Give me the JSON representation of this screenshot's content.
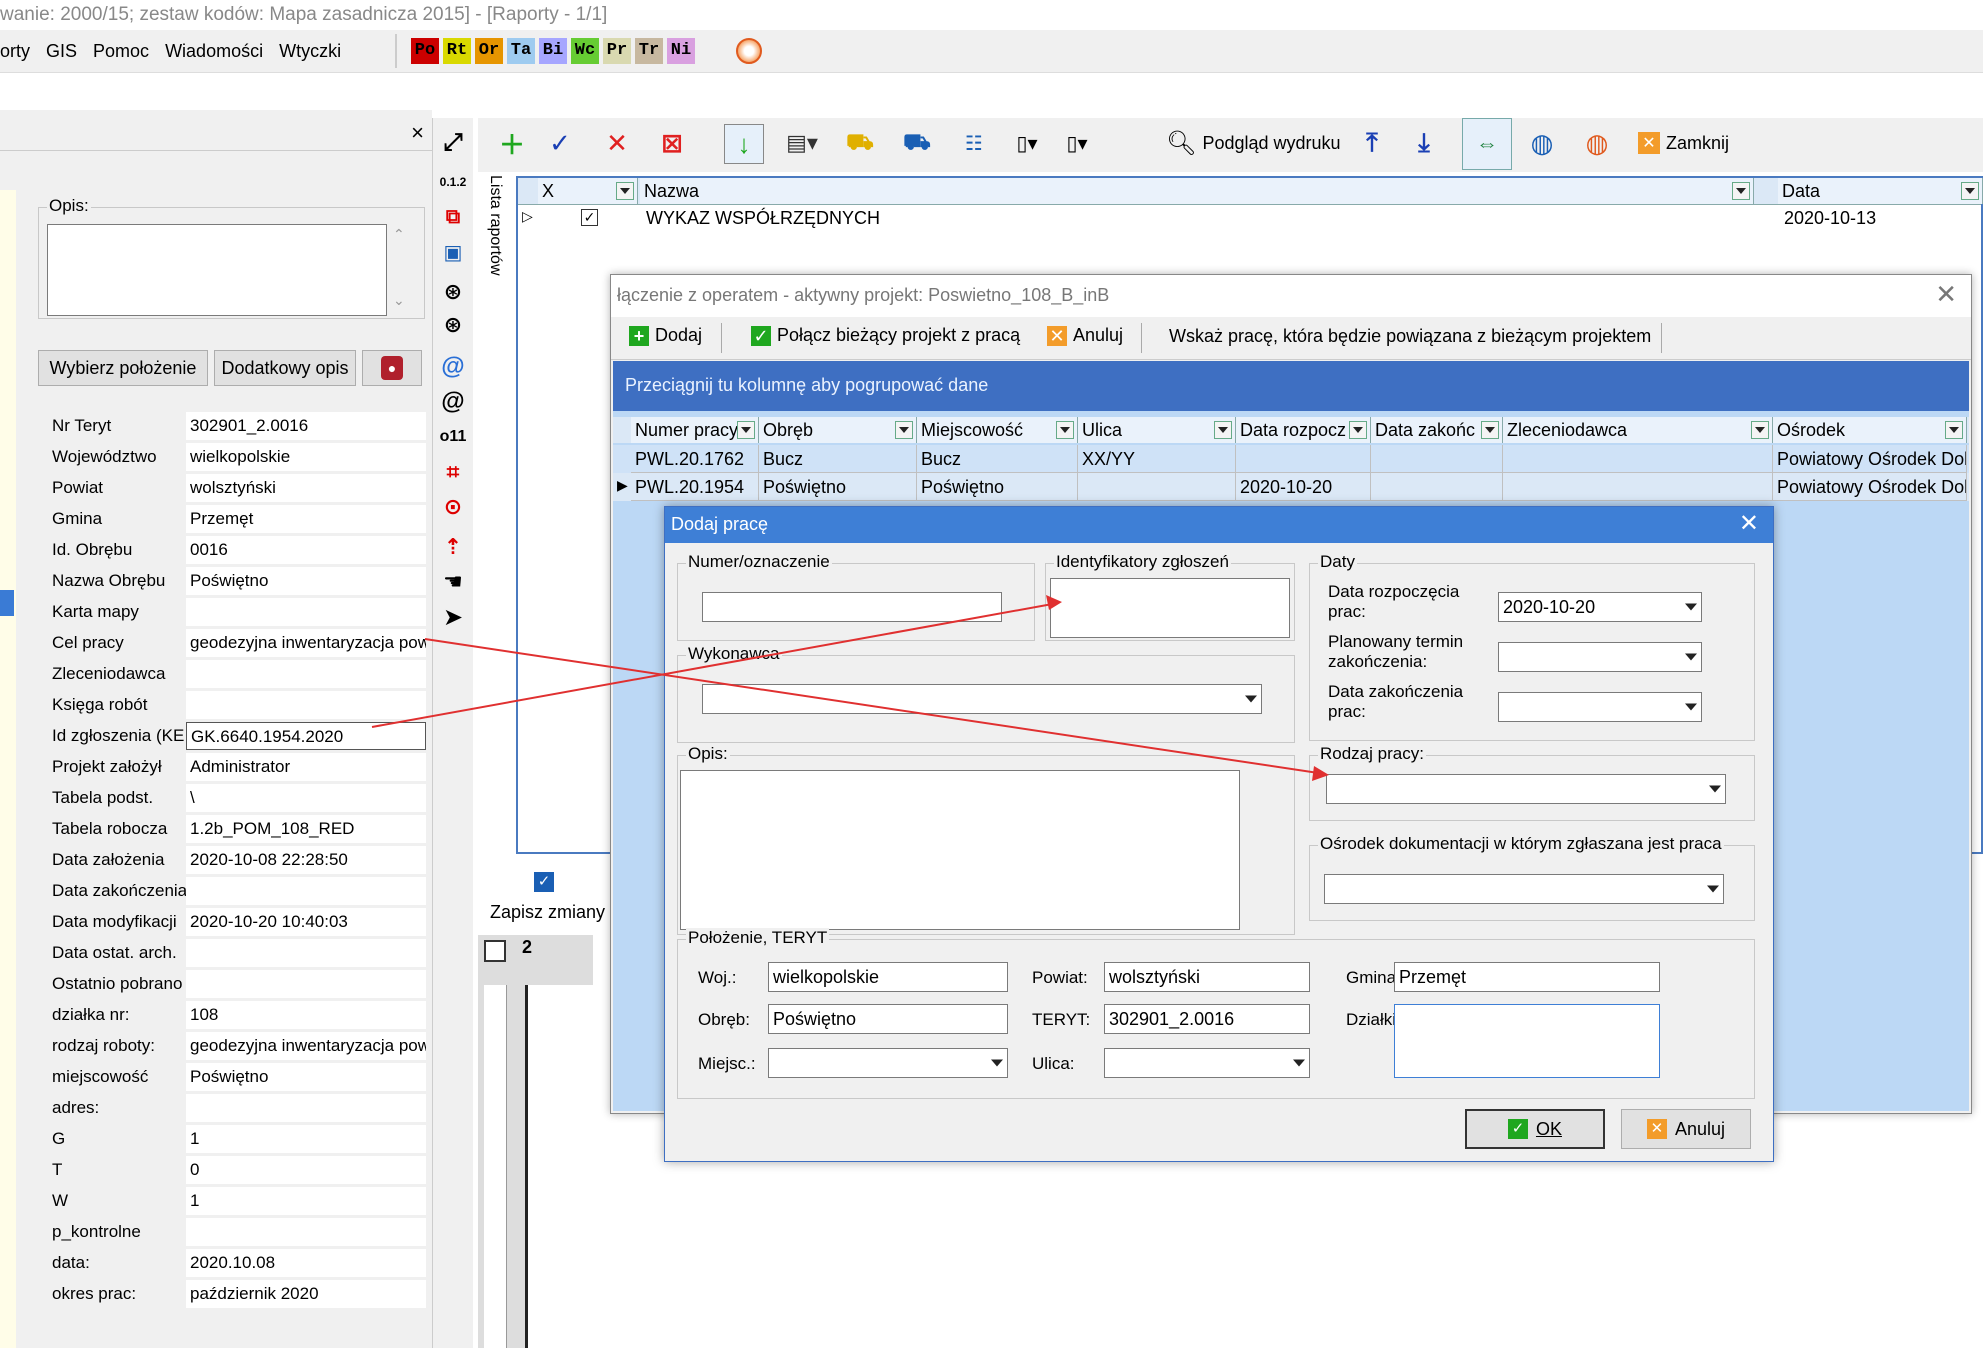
{
  "window": {
    "title": "wanie: 2000/15; zestaw kodów: Mapa zasadnicza 2015] - [Raporty - 1/1]"
  },
  "menu": {
    "items": [
      "orty",
      "GIS",
      "Pomoc",
      "Wiadomości",
      "Wtyczki"
    ],
    "badges": [
      {
        "label": "Po",
        "color": "#cc0000"
      },
      {
        "label": "Rt",
        "color": "#d9d900"
      },
      {
        "label": "Or",
        "color": "#e69500"
      },
      {
        "label": "Ta",
        "color": "#9ecbf0"
      },
      {
        "label": "Bi",
        "color": "#a6a6ff"
      },
      {
        "label": "Wc",
        "color": "#66cc33"
      },
      {
        "label": "Pr",
        "color": "#d9d9b0"
      },
      {
        "label": "Tr",
        "color": "#c7b8a0"
      },
      {
        "label": "Ni",
        "color": "#d9a0e0"
      }
    ]
  },
  "left_panel": {
    "close_label": "×",
    "opis_label": "Opis:",
    "btn_wybierz": "Wybierz położenie",
    "btn_dodatkowy": "Dodatkowy opis",
    "properties": [
      {
        "key": "Nr Teryt",
        "value": "302901_2.0016"
      },
      {
        "key": "Województwo",
        "value": "wielkopolskie"
      },
      {
        "key": "Powiat",
        "value": "wolsztyński"
      },
      {
        "key": "Gmina",
        "value": "Przemęt"
      },
      {
        "key": "Id. Obrębu",
        "value": "0016"
      },
      {
        "key": "Nazwa Obrębu",
        "value": "Poświętno"
      },
      {
        "key": "Karta mapy",
        "value": ""
      },
      {
        "key": "Cel pracy",
        "value": "geodezyjna inwentaryzacja pow"
      },
      {
        "key": "Zleceniodawca",
        "value": ""
      },
      {
        "key": "Księga robót",
        "value": ""
      },
      {
        "key": "Id zgłoszenia (KE",
        "value": "GK.6640.1954.2020"
      },
      {
        "key": "Projekt założył",
        "value": "Administrator"
      },
      {
        "key": "Tabela podst.",
        "value": "\\"
      },
      {
        "key": "Tabela robocza",
        "value": "1.2b_POM_108_RED"
      },
      {
        "key": "Data założenia",
        "value": "2020-10-08 22:28:50"
      },
      {
        "key": "Data zakończenia",
        "value": ""
      },
      {
        "key": "Data modyfikacji",
        "value": "2020-10-20 10:40:03"
      },
      {
        "key": "Data ostat. arch.",
        "value": ""
      },
      {
        "key": "Ostatnio pobrano",
        "value": ""
      },
      {
        "key": "działka nr:",
        "value": "108"
      },
      {
        "key": "rodzaj roboty:",
        "value": "geodezyjna inwentaryzacja pow"
      },
      {
        "key": "miejscowość",
        "value": "Poświętno"
      },
      {
        "key": "adres:",
        "value": ""
      },
      {
        "key": "G",
        "value": "1"
      },
      {
        "key": "T",
        "value": "0"
      },
      {
        "key": "W",
        "value": "1"
      },
      {
        "key": "p_kontrolne",
        "value": ""
      },
      {
        "key": "data:",
        "value": "2020.10.08"
      },
      {
        "key": "okres prac:",
        "value": "październik 2020"
      }
    ]
  },
  "reports": {
    "side_label": "Lista raportów",
    "toolbar_preview": "Podgląd wydruku",
    "toolbar_close": "Zamknij",
    "ruler_label": "0.1.2",
    "ruler_digit": "2",
    "o11_label": "o11",
    "grid_headers": [
      "X",
      "Nazwa",
      "Data"
    ],
    "grid_row": {
      "name": "WYKAZ WSPÓŁRZĘDNYCH",
      "date": "2020-10-13"
    },
    "save_changes": "Zapisz zmiany"
  },
  "link_dialog": {
    "title": "łączenie z operatem - aktywny projekt: Poswietno_108_B_inB",
    "btn_add": "Dodaj",
    "btn_connect": "Połącz bieżący projekt z pracą",
    "btn_cancel": "Anuluj",
    "hint": "Wskaż pracę, która będzie powiązana z bieżącym projektem",
    "group_hint": "Przeciągnij tu kolumnę aby pogrupować dane",
    "columns": [
      "Numer pracy",
      "Obręb",
      "Miejscowość",
      "Ulica",
      "Data rozpocz",
      "Data zakońc",
      "Zleceniodawca",
      "Ośrodek"
    ],
    "rows": [
      [
        "PWL.20.1762",
        "Bucz",
        "Bucz",
        "XX/YY",
        "",
        "",
        "",
        "Powiatowy Ośrodek Dok"
      ],
      [
        "PWL.20.1954",
        "Poświętno",
        "Poświętno",
        "",
        "2020-10-20",
        "",
        "",
        "Powiatowy Ośrodek Dok"
      ]
    ]
  },
  "add_dialog": {
    "title": "Dodaj pracę",
    "numer_label": "Numer/oznaczenie",
    "ident_label": "Identyfikatory zgłoszeń",
    "daty_label": "Daty",
    "data_rozp_label": "Data rozpoczęcia prac:",
    "data_rozp_value": "2020-10-20",
    "plan_label": "Planowany termin zakończenia:",
    "data_zak_label": "Data zakończenia prac:",
    "wykonawca_label": "Wykonawca",
    "opis_label": "Opis:",
    "rodzaj_label": "Rodzaj pracy:",
    "osrodek_label": "Ośrodek dokumentacji w którym zgłaszana jest praca",
    "polozenie_label": "Położenie, TERYT",
    "woj_label": "Woj.:",
    "woj_value": "wielkopolskie",
    "powiat_label": "Powiat:",
    "powiat_value": "wolsztyński",
    "gmina_label": "Gmina:",
    "gmina_value": "Przemęt",
    "obreb_label": "Obręb:",
    "obreb_value": "Poświętno",
    "teryt_label": "TERYT:",
    "teryt_value": "302901_2.0016",
    "dzialki_label": "Działki:",
    "miejsc_label": "Miejsc.:",
    "ulica_label": "Ulica:",
    "ok_label": "OK",
    "anuluj_label": "Anuluj"
  }
}
